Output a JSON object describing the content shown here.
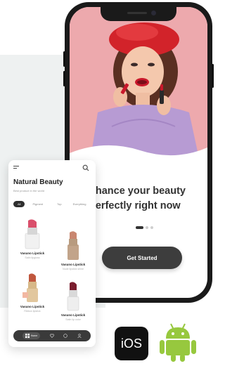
{
  "onboarding": {
    "headline_line1": "nhance your beauty",
    "headline_line2": "perfectly right now",
    "pager": {
      "total": 3,
      "active_index": 0
    },
    "cta_label": "Get Started"
  },
  "catalog": {
    "title": "Natural Beauty",
    "subtitle": "Best product in the world",
    "tabs": [
      "All",
      "Pigment",
      "Top",
      "Everything"
    ],
    "active_tab": 0,
    "products": [
      {
        "name": "Vasuno Lipstick",
        "desc": "Satin lipgloss",
        "color": "#d94f6b"
      },
      {
        "name": "Vasuno Lipstick",
        "desc": "Nude lipstick shine",
        "color": "#c98770"
      },
      {
        "name": "Vasuno Lipstick",
        "desc": "Ribbon lipstick",
        "color": "#c0573e"
      },
      {
        "name": "Vasuno Lipstick",
        "desc": "Satin lip color",
        "color": "#7a1d2e"
      }
    ],
    "bottom_nav": {
      "home_label": "Home",
      "icons": [
        "grid-icon",
        "heart-icon",
        "chat-icon",
        "profile-icon"
      ]
    }
  },
  "badges": {
    "ios_label": "iOS",
    "android_icon": "android-robot-icon",
    "android_color": "#97c83e"
  },
  "colors": {
    "hero_background": "#eda9ad",
    "button_dark": "#3d3d3d",
    "panel_background": "#eef1f1"
  }
}
